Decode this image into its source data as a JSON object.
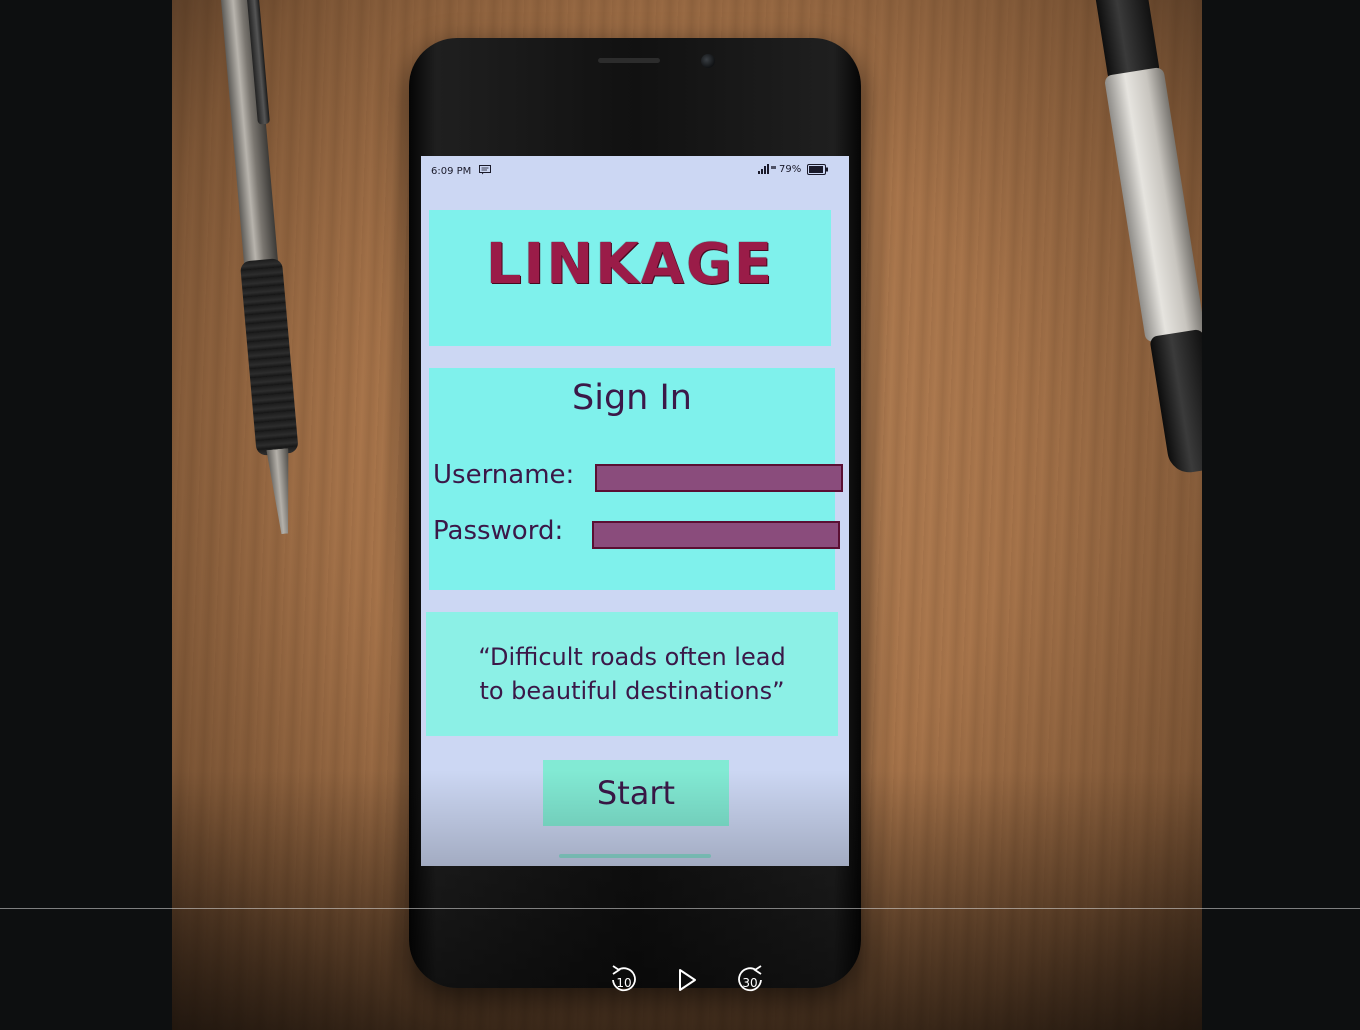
{
  "phone": {
    "status_bar": {
      "time": "6:09 PM",
      "battery": "79%"
    },
    "app": {
      "title": "LINKAGE",
      "signin_heading": "Sign In",
      "username_label": "Username:",
      "username_value": "",
      "password_label": "Password:",
      "password_value": "",
      "quote_line1": "“Difficult roads often lead",
      "quote_line2": "to beautiful destinations”",
      "start_label": "Start"
    },
    "colors": {
      "title": "#9a1c48",
      "panel": "#7ff1ec",
      "input_fill": "#8a4c7c",
      "text": "#3b1848",
      "screen_background": "#ccd7f3"
    }
  },
  "player": {
    "rewind_seconds": "10",
    "forward_seconds": "30",
    "progress": 0,
    "icons": {
      "rewind": "rewind-10-icon",
      "play": "play-icon",
      "forward": "forward-30-icon"
    }
  }
}
